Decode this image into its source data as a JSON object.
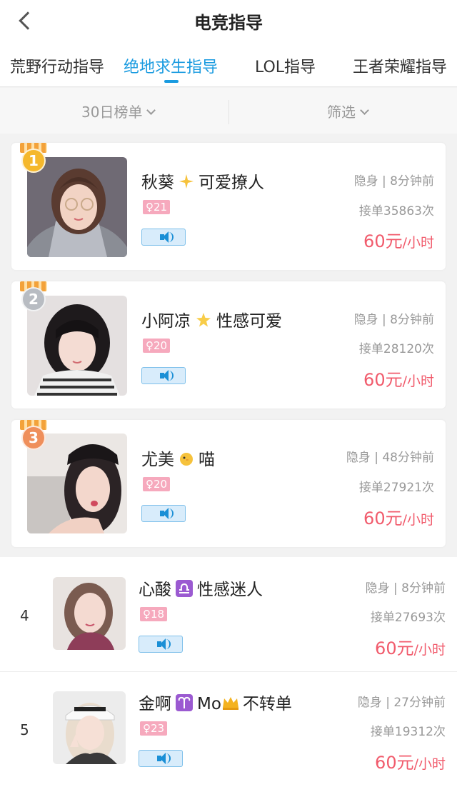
{
  "header": {
    "title": "电竞指导",
    "back_label": "<"
  },
  "tabs": [
    {
      "label": "荒野行动指导",
      "active": false
    },
    {
      "label": "绝地求生指导",
      "active": true
    },
    {
      "label": "LOL指导",
      "active": false
    },
    {
      "label": "王者荣耀指导",
      "active": false
    }
  ],
  "filters": {
    "ranking": "30日榜单",
    "filter": "筛选"
  },
  "colors": {
    "accent": "#1a9be0",
    "price": "#f15b6c",
    "gender_tag": "#f6a9bd"
  },
  "players": [
    {
      "rank": "1",
      "name": "秋葵",
      "emoji": "sparkles-icon",
      "tagline": "可爱撩人",
      "gender_age": "♀21",
      "status": "隐身 | 8分钟前",
      "orders": "接单35863次",
      "price": "60元",
      "unit": "/小时"
    },
    {
      "rank": "2",
      "name": "小阿凉",
      "emoji": "glowing-star-icon",
      "tagline": "性感可爱",
      "gender_age": "♀20",
      "status": "隐身 | 8分钟前",
      "orders": "接单28120次",
      "price": "60元",
      "unit": "/小时"
    },
    {
      "rank": "3",
      "name": "尤美",
      "emoji": "chick-icon",
      "tagline": "喵",
      "gender_age": "♀20",
      "status": "隐身 | 48分钟前",
      "orders": "接单27921次",
      "price": "60元",
      "unit": "/小时"
    },
    {
      "rank": "4",
      "name": "心酸",
      "emoji": "libra-icon",
      "tagline": "性感迷人",
      "gender_age": "♀18",
      "status": "隐身 | 8分钟前",
      "orders": "接单27693次",
      "price": "60元",
      "unit": "/小时"
    },
    {
      "rank": "5",
      "name": "金啊",
      "emoji": "aries-icon",
      "tagline": "不转单",
      "name_extra": "Mo",
      "emoji2": "crown-icon",
      "gender_age": "♀23",
      "status": "隐身 | 27分钟前",
      "orders": "接单19312次",
      "price": "60元",
      "unit": "/小时"
    }
  ]
}
